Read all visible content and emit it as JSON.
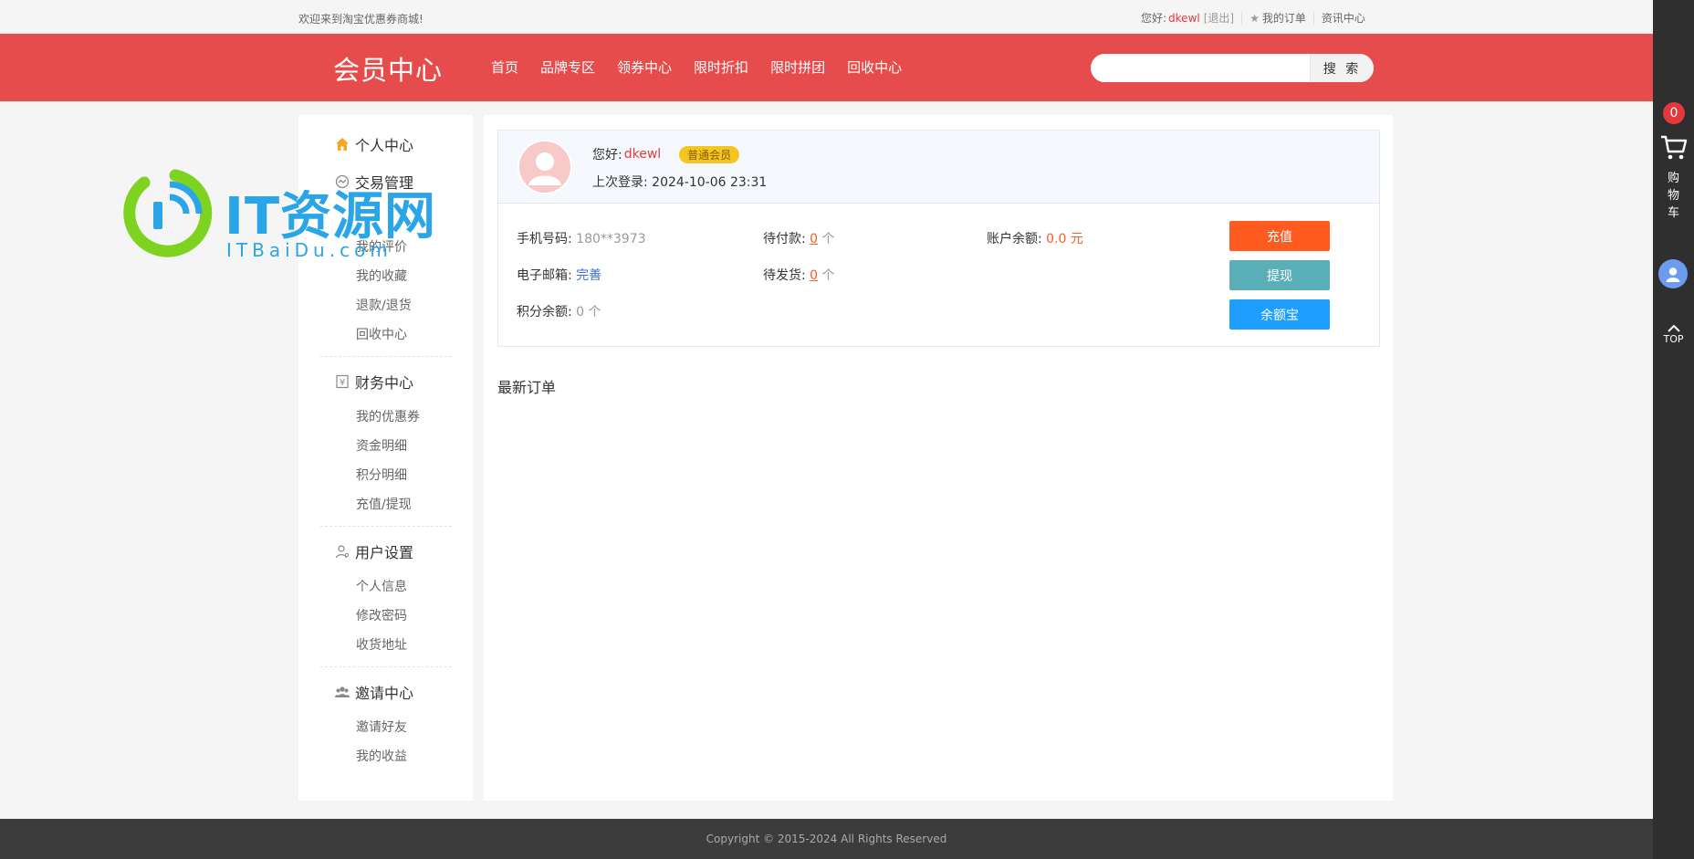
{
  "topbar": {
    "welcome": "欢迎来到淘宝优惠券商城!",
    "greeting": "您好:",
    "username": "dkewl",
    "logout": "[退出]",
    "my_orders": "我的订单",
    "news": "资讯中心"
  },
  "header": {
    "logo": "会员中心",
    "nav": [
      "首页",
      "品牌专区",
      "领券中心",
      "限时折扣",
      "限时拼团",
      "回收中心"
    ],
    "search_placeholder": "",
    "search_button": "搜 索"
  },
  "sidebar": {
    "groups": [
      {
        "title": "个人中心",
        "icon": "home-icon",
        "items": []
      },
      {
        "title": "交易管理",
        "icon": "trade-icon",
        "items": [
          "我的评价",
          "我的收藏",
          "退款/退货",
          "回收中心"
        ]
      },
      {
        "title": "财务中心",
        "icon": "finance-icon",
        "items": [
          "我的优惠券",
          "资金明细",
          "积分明细",
          "充值/提现"
        ]
      },
      {
        "title": "用户设置",
        "icon": "user-settings-icon",
        "items": [
          "个人信息",
          "修改密码",
          "收货地址"
        ]
      },
      {
        "title": "邀请中心",
        "icon": "invite-icon",
        "items": [
          "邀请好友",
          "我的收益"
        ]
      }
    ]
  },
  "profile": {
    "greeting": "您好:",
    "username": "dkewl",
    "level": "普通会员",
    "last_login_label": "上次登录:",
    "last_login": "2024-10-06 23:31",
    "phone_label": "手机号码:",
    "phone": "180**3973",
    "email_label": "电子邮箱:",
    "email": "完善",
    "points_label": "积分余额:",
    "points": "0 个",
    "pending_pay_label": "待付款:",
    "pending_pay": "0",
    "pending_ship_label": "待发货:",
    "pending_ship": "0",
    "unit": "个",
    "balance_label": "账户余额:",
    "balance": "0.0 元",
    "buttons": {
      "recharge": "充值",
      "withdraw": "提现",
      "yuebao": "余额宝"
    }
  },
  "main": {
    "latest_orders": "最新订单"
  },
  "footer": {
    "copyright": "Copyright © 2015-2024 All Rights Reserved"
  },
  "right_toolbar": {
    "cart_count": "0",
    "cart_label": "购物车",
    "top_label": "TOP"
  },
  "watermark": {
    "main": "IT资源网",
    "sub": "ITBaiDu.com"
  },
  "colors": {
    "brand": "#e64c4c",
    "recharge": "#ff5a1f",
    "withdraw": "#5aaeb8",
    "yuebao": "#1e9fff",
    "badge": "#f5c622"
  }
}
